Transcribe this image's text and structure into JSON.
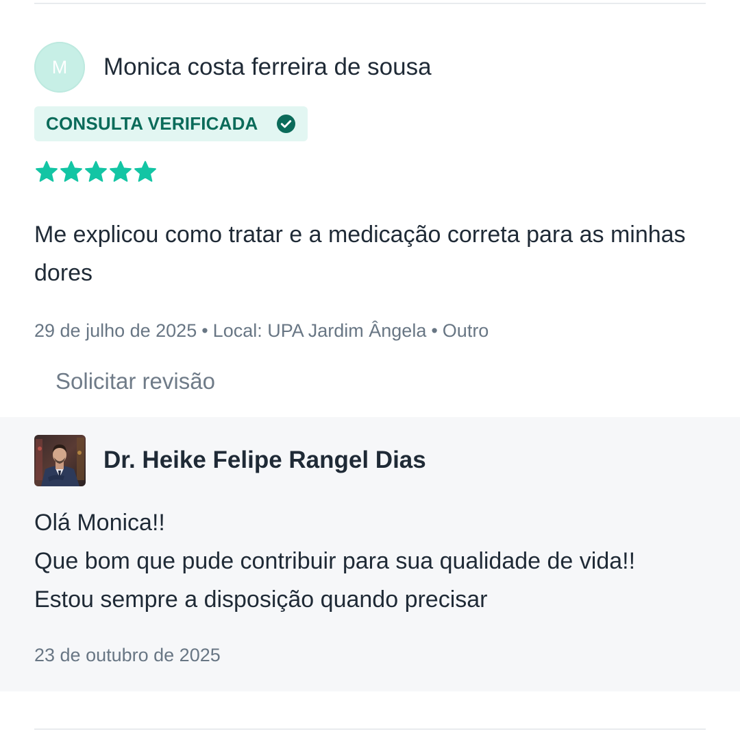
{
  "review": {
    "avatar_initial": "M",
    "reviewer_name": "Monica costa ferreira de sousa",
    "badge_label": "CONSULTA VERIFICADA",
    "rating": 5,
    "rating_max": 5,
    "text": "Me explicou como tratar e a medicação correta para as minhas dores",
    "date": "29 de julho de 2025",
    "location": "Local: UPA Jardim Ângela",
    "category": "Outro",
    "separator": "•",
    "request_review_label": "Solicitar revisão"
  },
  "reply": {
    "doctor_name": "Dr. Heike Felipe Rangel Dias",
    "lines": [
      "Olá Monica!!",
      "Que bom que pude contribuir para sua qualidade de vida!!",
      "Estou sempre a disposição quando precisar"
    ],
    "date": "23 de outubro de 2025"
  },
  "colors": {
    "star": "#13c5a4",
    "badge_bg": "#e2f6f2",
    "badge_text": "#0b6b5a",
    "avatar_bg": "#c7efe6",
    "reply_bg": "#f6f7f9",
    "meta_text": "#687684"
  },
  "icons": {
    "verified": "check-circle-icon",
    "star": "star-icon"
  }
}
